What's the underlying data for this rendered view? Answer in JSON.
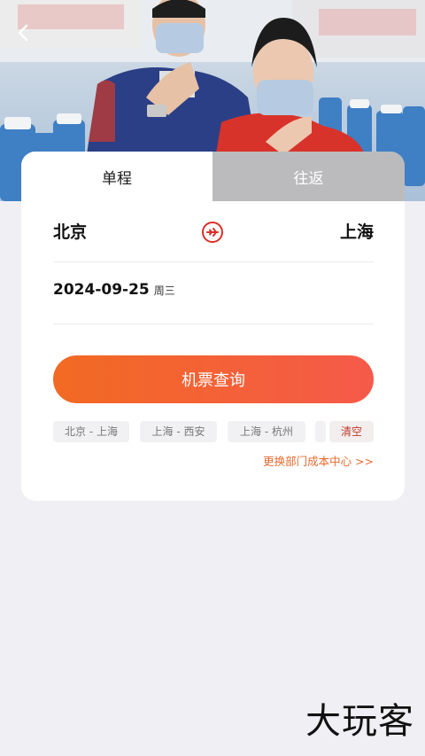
{
  "nav": {
    "back_icon": "chevron-left-icon"
  },
  "tabs": {
    "one_way": "单程",
    "round_trip": "往返"
  },
  "route": {
    "from": "北京",
    "to": "上海",
    "swap_icon": "plane-swap-icon"
  },
  "date": {
    "value": "2024-09-25",
    "weekday": "周三"
  },
  "search": {
    "label": "机票查询"
  },
  "history": {
    "items": [
      "北京 - 上海",
      "上海 - 西安",
      "上海 - 杭州"
    ],
    "clear_label": "清空"
  },
  "cost_center_link": "更换部门成本中心 >>",
  "watermark": "大玩客",
  "colors": {
    "accent": "#f26a22",
    "accent_end": "#f55a4a",
    "clear": "#c0392b",
    "link": "#e56a2d",
    "swap_icon": "#d9302a"
  }
}
